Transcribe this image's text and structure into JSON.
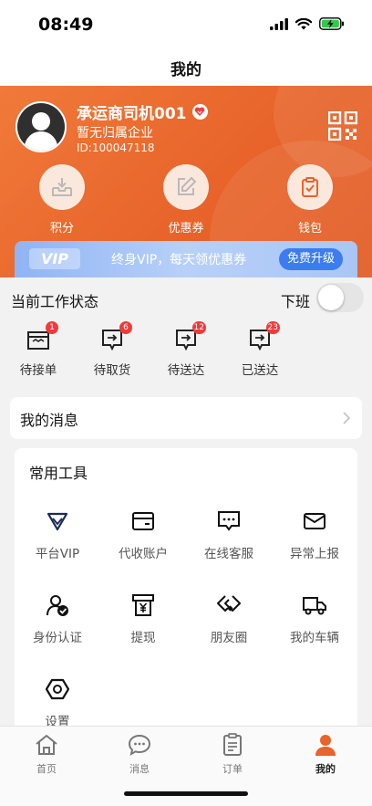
{
  "status_bar": {
    "time": "08:49"
  },
  "nav": {
    "title": "我的"
  },
  "profile": {
    "name": "承运商司机001",
    "company": "暂无归属企业",
    "user_id": "ID:100047118"
  },
  "wallet": [
    {
      "label": "积分",
      "icon": "inbox-download-icon"
    },
    {
      "label": "优惠券",
      "icon": "edit-icon"
    },
    {
      "label": "钱包",
      "icon": "clipboard-icon"
    }
  ],
  "vip_banner": {
    "tag": "VIP",
    "text": "终身VIP，每天领优惠券",
    "button": "免费升级"
  },
  "work_status": {
    "label": "当前工作状态",
    "state_label": "下班",
    "toggle_on": false
  },
  "orders": [
    {
      "label": "待接单",
      "badge": "1"
    },
    {
      "label": "待取货",
      "badge": "6"
    },
    {
      "label": "待送达",
      "badge": "12"
    },
    {
      "label": "已送达",
      "badge": "23"
    }
  ],
  "messages": {
    "label": "我的消息"
  },
  "tools": {
    "title": "常用工具",
    "items": [
      {
        "label": "平台VIP",
        "icon": "vip-diamond-icon"
      },
      {
        "label": "代收账户",
        "icon": "card-icon"
      },
      {
        "label": "在线客服",
        "icon": "chat-icon"
      },
      {
        "label": "异常上报",
        "icon": "mail-icon"
      },
      {
        "label": "身份认证",
        "icon": "user-check-icon"
      },
      {
        "label": "提现",
        "icon": "yen-receipt-icon"
      },
      {
        "label": "朋友圈",
        "icon": "handshake-icon"
      },
      {
        "label": "我的车辆",
        "icon": "truck-icon"
      },
      {
        "label": "设置",
        "icon": "settings-hex-icon"
      }
    ]
  },
  "tab_bar": [
    {
      "label": "首页",
      "icon": "home-icon",
      "active": false
    },
    {
      "label": "消息",
      "icon": "message-icon",
      "active": false
    },
    {
      "label": "订单",
      "icon": "order-list-icon",
      "active": false
    },
    {
      "label": "我的",
      "icon": "profile-icon",
      "active": true
    }
  ],
  "colors": {
    "brand_orange": "#e8642a",
    "vip_blue": "#3d7cf0",
    "badge_red": "#ef3b3b"
  }
}
